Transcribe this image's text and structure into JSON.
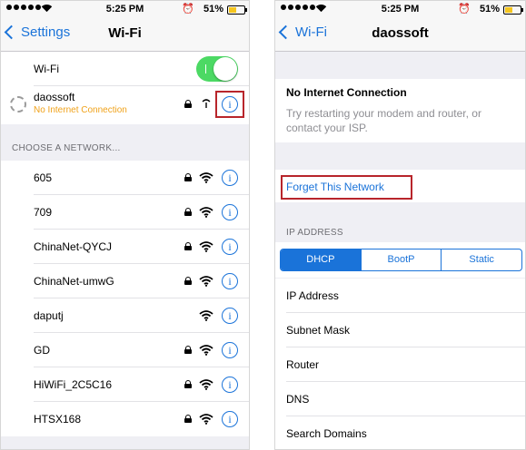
{
  "left": {
    "status": {
      "time": "5:25 PM",
      "battery": "51%",
      "battery_level": 0.51
    },
    "nav": {
      "back_label": "Settings",
      "title": "Wi-Fi"
    },
    "wifi_row": {
      "label": "Wi-Fi",
      "toggle_on": true
    },
    "connected": {
      "name": "daossoft",
      "status": "No Internet Connection"
    },
    "section_header": "CHOOSE A NETWORK...",
    "networks": [
      {
        "name": "605",
        "locked": true
      },
      {
        "name": "709",
        "locked": true
      },
      {
        "name": "ChinaNet-QYCJ",
        "locked": true
      },
      {
        "name": "ChinaNet-umwG",
        "locked": true
      },
      {
        "name": "daputj",
        "locked": false
      },
      {
        "name": "GD",
        "locked": true
      },
      {
        "name": "HiWiFi_2C5C16",
        "locked": true
      },
      {
        "name": "HTSX168",
        "locked": true
      }
    ]
  },
  "right": {
    "status": {
      "time": "5:25 PM",
      "battery": "51%",
      "battery_level": 0.51
    },
    "nav": {
      "back_label": "Wi-Fi",
      "title": "daossoft"
    },
    "warning": {
      "title": "No Internet Connection",
      "line1": "Try restarting your modem and router, or",
      "line2": "contact your ISP."
    },
    "forget_label": "Forget This Network",
    "ip_header": "IP ADDRESS",
    "segments": [
      "DHCP",
      "BootP",
      "Static"
    ],
    "ip_rows": [
      "IP Address",
      "Subnet Mask",
      "Router",
      "DNS",
      "Search Domains"
    ]
  },
  "colors": {
    "accent": "#1a73d9",
    "toggle_green": "#4cd964",
    "warning_orange": "#f0a21a",
    "highlight_red": "#b8252b"
  }
}
